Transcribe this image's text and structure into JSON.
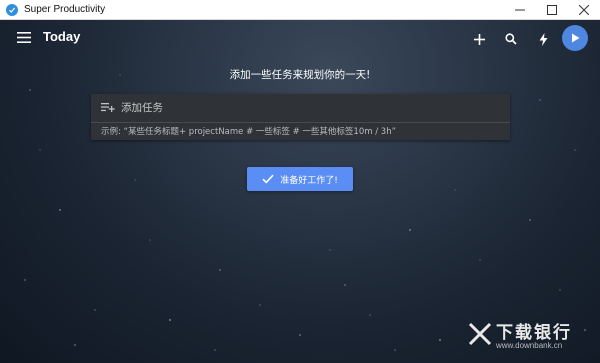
{
  "window": {
    "title": "Super Productivity"
  },
  "toolbar": {
    "page_title": "Today"
  },
  "main": {
    "prompt": "添加一些任务来规划你的一天!",
    "add_task_placeholder": "添加任务",
    "example": "示例: “某些任务标题+ projectName # 一些标签 # 一些其他标签10m / 3h”",
    "ready_button": "准备好工作了!"
  },
  "watermark": {
    "title": "下载银行",
    "url": "www.downbank.cn"
  },
  "colors": {
    "accent": "#5b8ef5",
    "play": "#4e86e0",
    "app_icon": "#2f8fdc"
  }
}
